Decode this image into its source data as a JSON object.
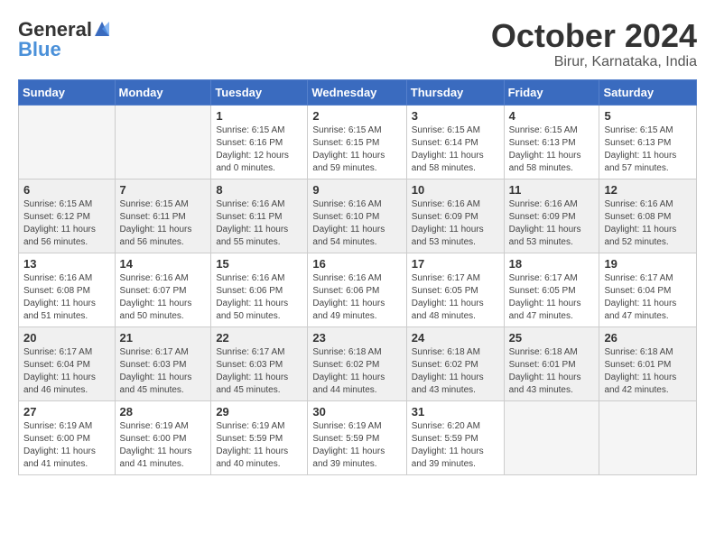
{
  "logo": {
    "general": "General",
    "blue": "Blue"
  },
  "title": "October 2024",
  "location": "Birur, Karnataka, India",
  "weekdays": [
    "Sunday",
    "Monday",
    "Tuesday",
    "Wednesday",
    "Thursday",
    "Friday",
    "Saturday"
  ],
  "weeks": [
    [
      {
        "day": "",
        "info": ""
      },
      {
        "day": "",
        "info": ""
      },
      {
        "day": "1",
        "info": "Sunrise: 6:15 AM\nSunset: 6:16 PM\nDaylight: 12 hours\nand 0 minutes."
      },
      {
        "day": "2",
        "info": "Sunrise: 6:15 AM\nSunset: 6:15 PM\nDaylight: 11 hours\nand 59 minutes."
      },
      {
        "day": "3",
        "info": "Sunrise: 6:15 AM\nSunset: 6:14 PM\nDaylight: 11 hours\nand 58 minutes."
      },
      {
        "day": "4",
        "info": "Sunrise: 6:15 AM\nSunset: 6:13 PM\nDaylight: 11 hours\nand 58 minutes."
      },
      {
        "day": "5",
        "info": "Sunrise: 6:15 AM\nSunset: 6:13 PM\nDaylight: 11 hours\nand 57 minutes."
      }
    ],
    [
      {
        "day": "6",
        "info": "Sunrise: 6:15 AM\nSunset: 6:12 PM\nDaylight: 11 hours\nand 56 minutes."
      },
      {
        "day": "7",
        "info": "Sunrise: 6:15 AM\nSunset: 6:11 PM\nDaylight: 11 hours\nand 56 minutes."
      },
      {
        "day": "8",
        "info": "Sunrise: 6:16 AM\nSunset: 6:11 PM\nDaylight: 11 hours\nand 55 minutes."
      },
      {
        "day": "9",
        "info": "Sunrise: 6:16 AM\nSunset: 6:10 PM\nDaylight: 11 hours\nand 54 minutes."
      },
      {
        "day": "10",
        "info": "Sunrise: 6:16 AM\nSunset: 6:09 PM\nDaylight: 11 hours\nand 53 minutes."
      },
      {
        "day": "11",
        "info": "Sunrise: 6:16 AM\nSunset: 6:09 PM\nDaylight: 11 hours\nand 53 minutes."
      },
      {
        "day": "12",
        "info": "Sunrise: 6:16 AM\nSunset: 6:08 PM\nDaylight: 11 hours\nand 52 minutes."
      }
    ],
    [
      {
        "day": "13",
        "info": "Sunrise: 6:16 AM\nSunset: 6:08 PM\nDaylight: 11 hours\nand 51 minutes."
      },
      {
        "day": "14",
        "info": "Sunrise: 6:16 AM\nSunset: 6:07 PM\nDaylight: 11 hours\nand 50 minutes."
      },
      {
        "day": "15",
        "info": "Sunrise: 6:16 AM\nSunset: 6:06 PM\nDaylight: 11 hours\nand 50 minutes."
      },
      {
        "day": "16",
        "info": "Sunrise: 6:16 AM\nSunset: 6:06 PM\nDaylight: 11 hours\nand 49 minutes."
      },
      {
        "day": "17",
        "info": "Sunrise: 6:17 AM\nSunset: 6:05 PM\nDaylight: 11 hours\nand 48 minutes."
      },
      {
        "day": "18",
        "info": "Sunrise: 6:17 AM\nSunset: 6:05 PM\nDaylight: 11 hours\nand 47 minutes."
      },
      {
        "day": "19",
        "info": "Sunrise: 6:17 AM\nSunset: 6:04 PM\nDaylight: 11 hours\nand 47 minutes."
      }
    ],
    [
      {
        "day": "20",
        "info": "Sunrise: 6:17 AM\nSunset: 6:04 PM\nDaylight: 11 hours\nand 46 minutes."
      },
      {
        "day": "21",
        "info": "Sunrise: 6:17 AM\nSunset: 6:03 PM\nDaylight: 11 hours\nand 45 minutes."
      },
      {
        "day": "22",
        "info": "Sunrise: 6:17 AM\nSunset: 6:03 PM\nDaylight: 11 hours\nand 45 minutes."
      },
      {
        "day": "23",
        "info": "Sunrise: 6:18 AM\nSunset: 6:02 PM\nDaylight: 11 hours\nand 44 minutes."
      },
      {
        "day": "24",
        "info": "Sunrise: 6:18 AM\nSunset: 6:02 PM\nDaylight: 11 hours\nand 43 minutes."
      },
      {
        "day": "25",
        "info": "Sunrise: 6:18 AM\nSunset: 6:01 PM\nDaylight: 11 hours\nand 43 minutes."
      },
      {
        "day": "26",
        "info": "Sunrise: 6:18 AM\nSunset: 6:01 PM\nDaylight: 11 hours\nand 42 minutes."
      }
    ],
    [
      {
        "day": "27",
        "info": "Sunrise: 6:19 AM\nSunset: 6:00 PM\nDaylight: 11 hours\nand 41 minutes."
      },
      {
        "day": "28",
        "info": "Sunrise: 6:19 AM\nSunset: 6:00 PM\nDaylight: 11 hours\nand 41 minutes."
      },
      {
        "day": "29",
        "info": "Sunrise: 6:19 AM\nSunset: 5:59 PM\nDaylight: 11 hours\nand 40 minutes."
      },
      {
        "day": "30",
        "info": "Sunrise: 6:19 AM\nSunset: 5:59 PM\nDaylight: 11 hours\nand 39 minutes."
      },
      {
        "day": "31",
        "info": "Sunrise: 6:20 AM\nSunset: 5:59 PM\nDaylight: 11 hours\nand 39 minutes."
      },
      {
        "day": "",
        "info": ""
      },
      {
        "day": "",
        "info": ""
      }
    ]
  ]
}
